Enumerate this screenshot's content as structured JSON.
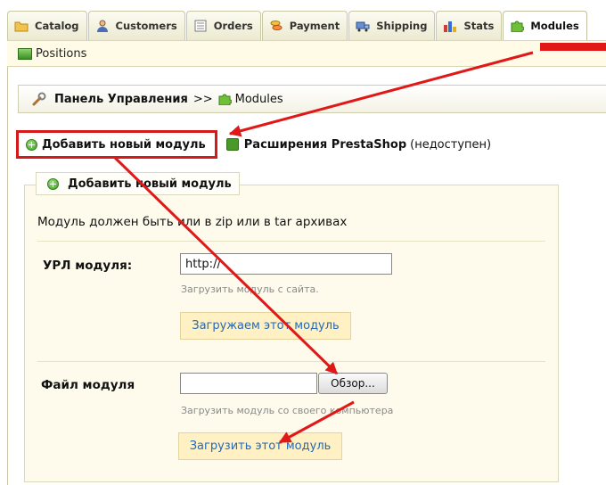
{
  "tabs": [
    {
      "label": "Catalog",
      "icon": "folder-icon"
    },
    {
      "label": "Customers",
      "icon": "user-icon"
    },
    {
      "label": "Orders",
      "icon": "document-icon"
    },
    {
      "label": "Payment",
      "icon": "coins-icon"
    },
    {
      "label": "Shipping",
      "icon": "truck-icon"
    },
    {
      "label": "Stats",
      "icon": "bar-chart-icon"
    },
    {
      "label": "Modules",
      "icon": "puzzle-icon"
    }
  ],
  "subnav": {
    "positions": "Positions"
  },
  "breadcrumb": {
    "root": "Панель Управления",
    "separator": ">>",
    "current": "Modules"
  },
  "actions": {
    "add_module": "Добавить новый модуль",
    "extensions": "Расширения PrestaShop",
    "extensions_status": "(недоступен)"
  },
  "form": {
    "legend": "Добавить новый модуль",
    "note": "Модуль должен быть или в zip или в tar архивах",
    "url_label": "УРЛ модуля:",
    "url_value": "http://",
    "url_hint": "Загрузить модуль с сайта.",
    "url_button": "Загружаем этот модуль",
    "file_label": "Файл модуля",
    "file_value": "",
    "browse_button": "Обзор...",
    "file_hint": "Загрузить модуль со своего компьютера",
    "file_button": "Загрузить этот модуль"
  },
  "colors": {
    "annotation_red": "#e01818",
    "link_blue": "#2468b8",
    "panel_bg": "#fffbec"
  }
}
